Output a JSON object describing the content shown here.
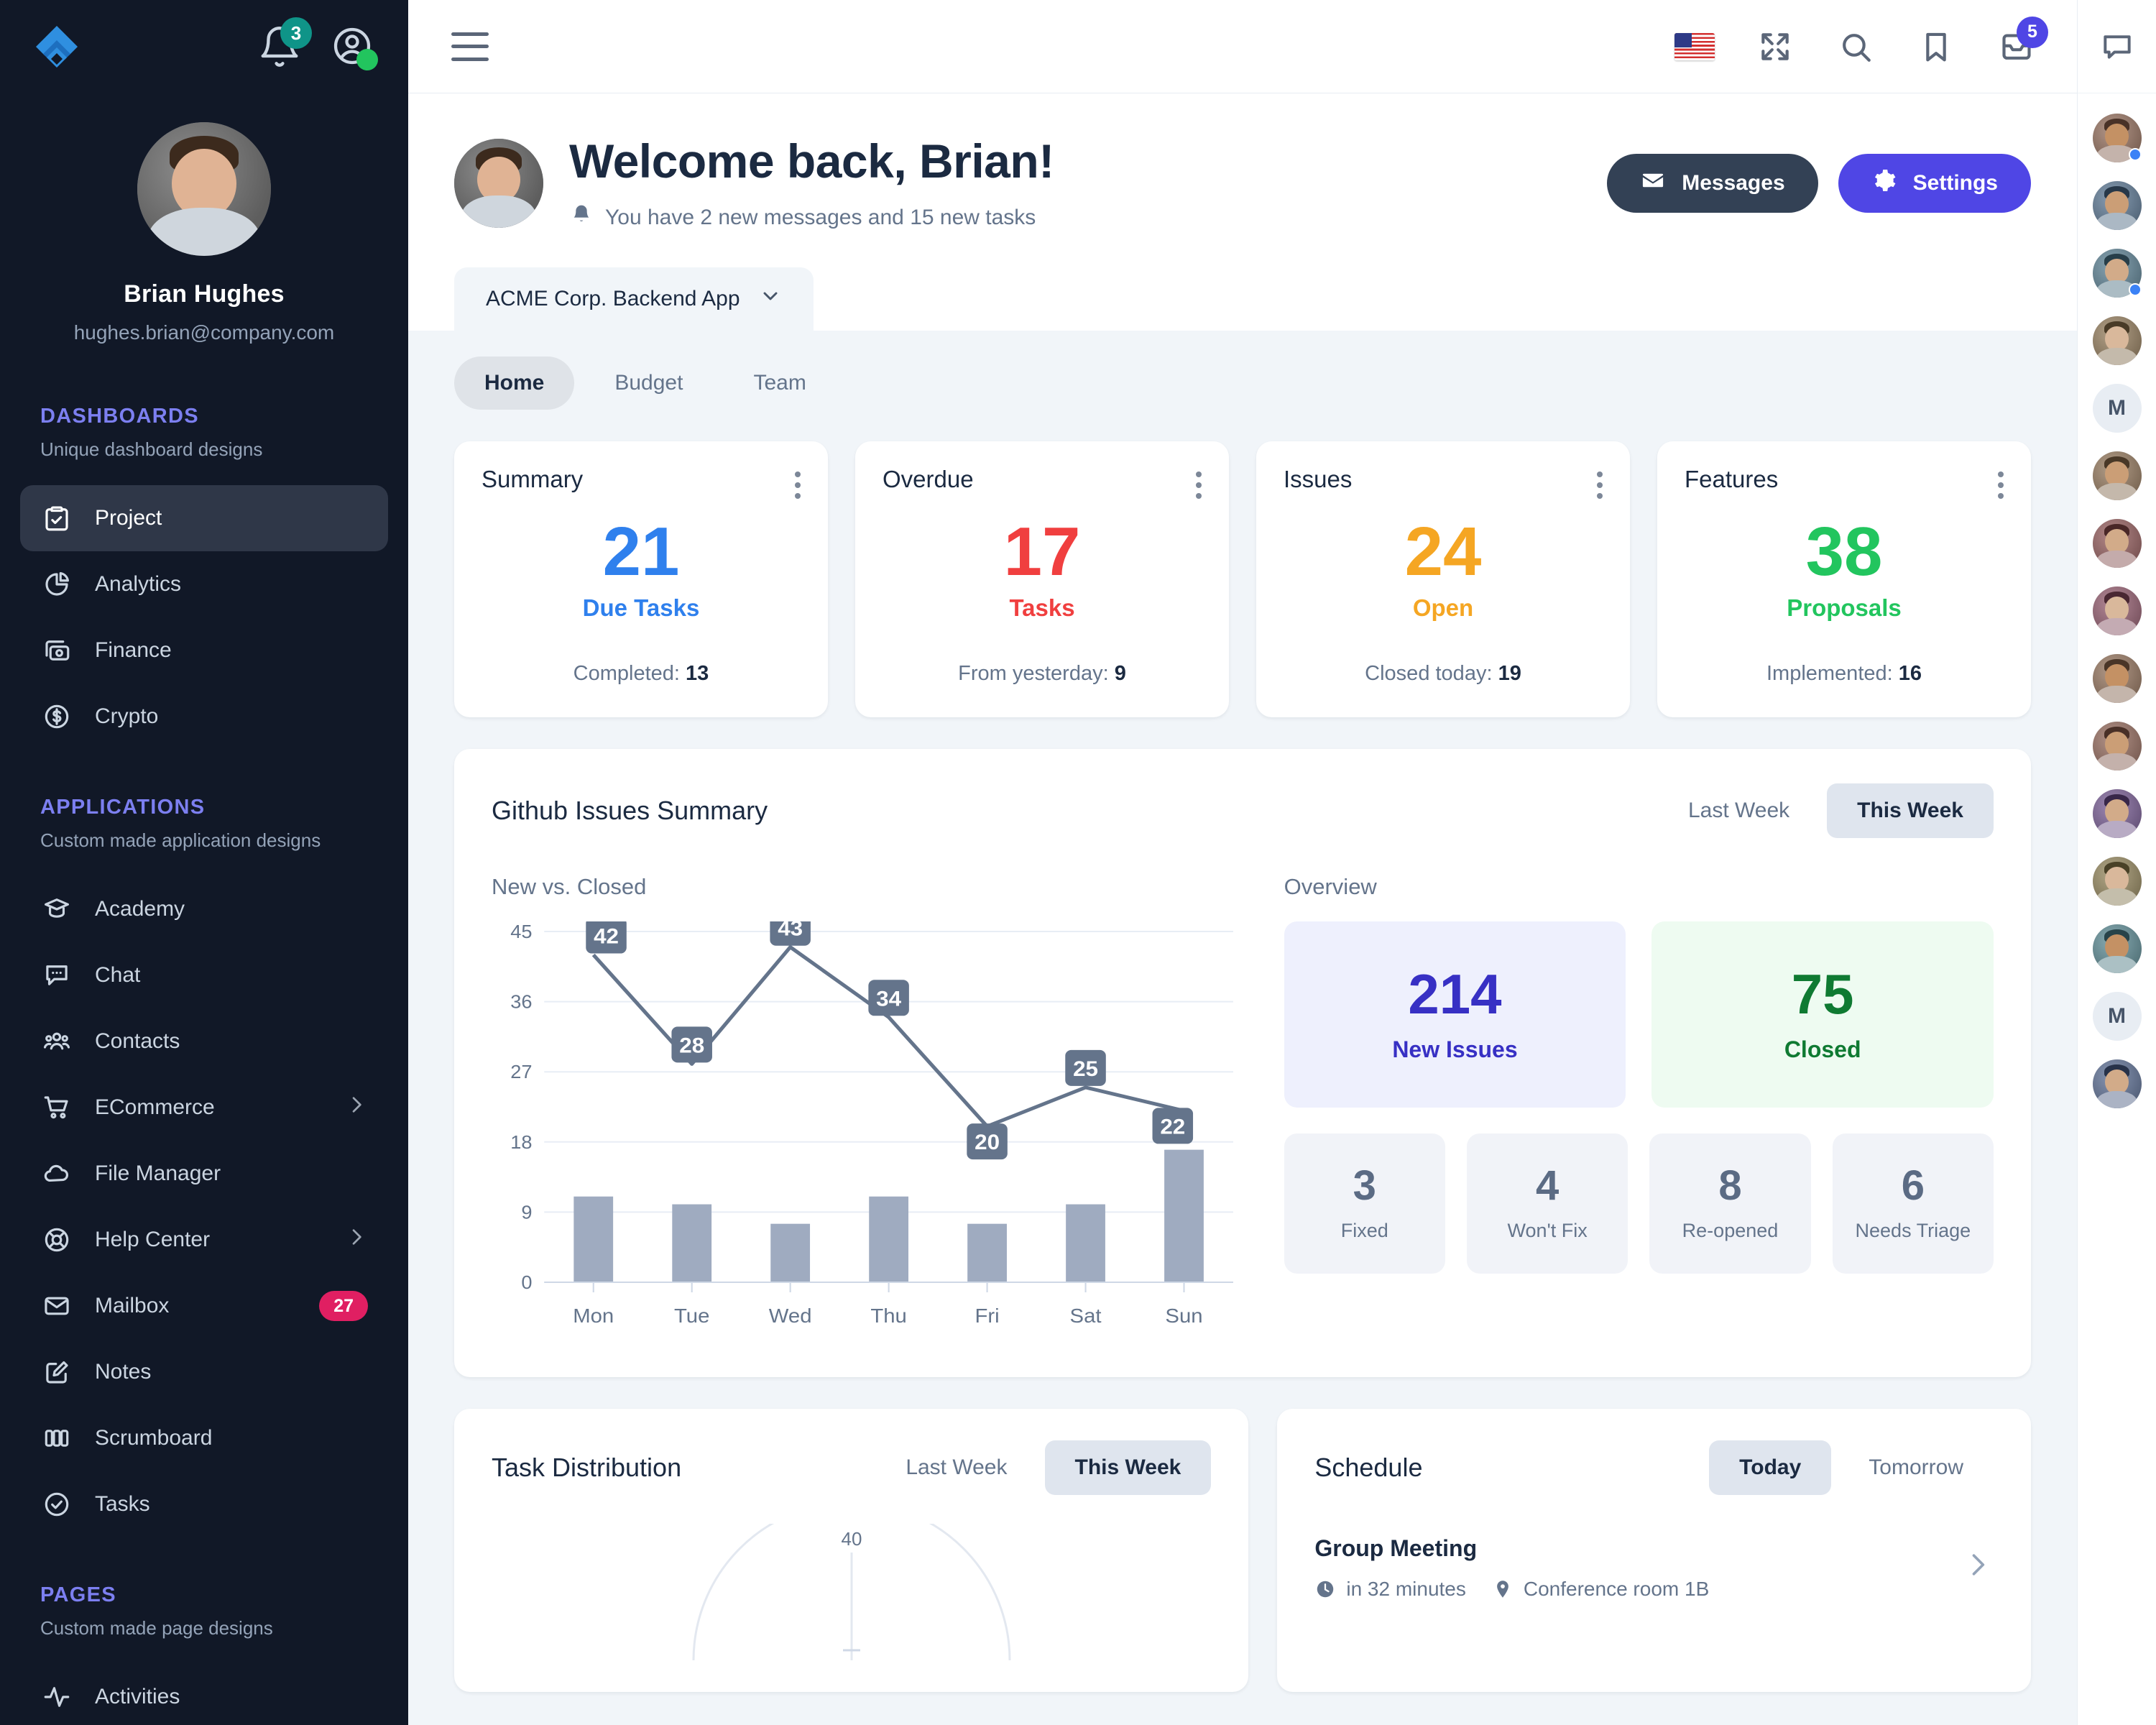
{
  "sidebar": {
    "brand_icon": "logo-icon",
    "notifications_count": "3",
    "profile": {
      "name": "Brian Hughes",
      "email": "hughes.brian@company.com"
    },
    "sections": [
      {
        "title": "DASHBOARDS",
        "subtitle": "Unique dashboard designs",
        "items": [
          {
            "label": "Project",
            "icon": "clipboard-check-icon",
            "active": true
          },
          {
            "label": "Analytics",
            "icon": "pie-chart-icon",
            "active": false
          },
          {
            "label": "Finance",
            "icon": "money-icon",
            "active": false
          },
          {
            "label": "Crypto",
            "icon": "dollar-circle-icon",
            "active": false
          }
        ]
      },
      {
        "title": "APPLICATIONS",
        "subtitle": "Custom made application designs",
        "items": [
          {
            "label": "Academy",
            "icon": "graduation-cap-icon"
          },
          {
            "label": "Chat",
            "icon": "chat-bubble-icon"
          },
          {
            "label": "Contacts",
            "icon": "people-icon"
          },
          {
            "label": "ECommerce",
            "icon": "shopping-cart-icon",
            "chevron": true
          },
          {
            "label": "File Manager",
            "icon": "cloud-icon"
          },
          {
            "label": "Help Center",
            "icon": "lifebuoy-icon",
            "chevron": true
          },
          {
            "label": "Mailbox",
            "icon": "envelope-icon",
            "badge": "27"
          },
          {
            "label": "Notes",
            "icon": "note-edit-icon"
          },
          {
            "label": "Scrumboard",
            "icon": "columns-icon"
          },
          {
            "label": "Tasks",
            "icon": "check-circle-icon"
          }
        ]
      },
      {
        "title": "PAGES",
        "subtitle": "Custom made page designs",
        "items": [
          {
            "label": "Activities",
            "icon": "activity-icon"
          }
        ]
      }
    ]
  },
  "topbar": {
    "menu_icon": "hamburger-icon",
    "icons": [
      "us-flag-icon",
      "fullscreen-icon",
      "search-icon",
      "bookmark-icon",
      "inbox-icon"
    ],
    "inbox_badge": "5"
  },
  "hero": {
    "title": "Welcome back, Brian!",
    "subtitle": "You have 2 new messages and 15 new tasks",
    "bell_icon": "bell-icon",
    "messages_button": "Messages",
    "settings_button": "Settings",
    "project_tab": "ACME Corp. Backend App"
  },
  "subtabs": [
    {
      "label": "Home",
      "active": true
    },
    {
      "label": "Budget",
      "active": false
    },
    {
      "label": "Team",
      "active": false
    }
  ],
  "summary_cards": [
    {
      "title": "Summary",
      "value": "21",
      "value_label": "Due Tasks",
      "foot_label": "Completed:",
      "foot_value": "13",
      "color": "#2f80ed"
    },
    {
      "title": "Overdue",
      "value": "17",
      "value_label": "Tasks",
      "foot_label": "From yesterday:",
      "foot_value": "9",
      "color": "#f03f3f"
    },
    {
      "title": "Issues",
      "value": "24",
      "value_label": "Open",
      "foot_label": "Closed today:",
      "foot_value": "19",
      "color": "#f5a623"
    },
    {
      "title": "Features",
      "value": "38",
      "value_label": "Proposals",
      "foot_label": "Implemented:",
      "foot_value": "16",
      "color": "#22c55e"
    }
  ],
  "github_panel": {
    "title": "Github Issues Summary",
    "range_tabs": [
      {
        "label": "Last Week",
        "active": false
      },
      {
        "label": "This Week",
        "active": true
      }
    ],
    "left_heading": "New vs. Closed",
    "right_heading": "Overview",
    "overview_cards": [
      {
        "value": "214",
        "label": "New Issues",
        "color": "#3730c4",
        "bg": "#eef0fd"
      },
      {
        "value": "75",
        "label": "Closed",
        "color": "#0f7a32",
        "bg": "#eefbf1"
      }
    ],
    "mini_cards": [
      {
        "value": "3",
        "label": "Fixed"
      },
      {
        "value": "4",
        "label": "Won't Fix"
      },
      {
        "value": "8",
        "label": "Re-opened"
      },
      {
        "value": "6",
        "label": "Needs Triage"
      }
    ]
  },
  "task_distribution": {
    "title": "Task Distribution",
    "range_tabs": [
      {
        "label": "Last Week",
        "active": false
      },
      {
        "label": "This Week",
        "active": true
      }
    ],
    "gauge_top_label": "40"
  },
  "schedule": {
    "title": "Schedule",
    "range_tabs": [
      {
        "label": "Today",
        "active": true
      },
      {
        "label": "Tomorrow",
        "active": false
      }
    ],
    "event_title": "Group Meeting",
    "event_time": "in 32 minutes",
    "event_location": "Conference room 1B",
    "clock_icon": "clock-icon",
    "pin_icon": "map-pin-icon",
    "chevron_icon": "chevron-right-icon"
  },
  "chart_data": {
    "type": "line",
    "title": "New vs. Closed",
    "categories": [
      "Mon",
      "Tue",
      "Wed",
      "Thu",
      "Fri",
      "Sat",
      "Sun"
    ],
    "series": [
      {
        "name": "New",
        "type": "line",
        "values": [
          42,
          28,
          43,
          34,
          20,
          25,
          22
        ],
        "color": "#64748b",
        "labels": true
      },
      {
        "name": "Closed",
        "type": "bar",
        "values": [
          11,
          10,
          7.5,
          11,
          7.5,
          10,
          17
        ],
        "color": "#9fabc0",
        "labels": false
      }
    ],
    "ylim": [
      0,
      45
    ],
    "yticks": [
      0,
      9,
      18,
      27,
      36,
      45
    ],
    "xlabel": "",
    "ylabel": "",
    "grid": true,
    "legend": "none"
  },
  "rail": {
    "chat_icon": "chat-panel-icon",
    "contacts": [
      {
        "type": "photo",
        "status": "#3b82f6",
        "hue": 20
      },
      {
        "type": "photo",
        "status": "",
        "hue": 210
      },
      {
        "type": "photo",
        "status": "#3b82f6",
        "hue": 200
      },
      {
        "type": "photo",
        "status": "",
        "hue": 35
      },
      {
        "type": "initial",
        "label": "M",
        "status": ""
      },
      {
        "type": "photo",
        "status": "",
        "hue": 30
      },
      {
        "type": "photo",
        "status": "",
        "hue": 0
      },
      {
        "type": "photo",
        "status": "",
        "hue": 340
      },
      {
        "type": "photo",
        "status": "",
        "hue": 25
      },
      {
        "type": "photo",
        "status": "",
        "hue": 15
      },
      {
        "type": "photo",
        "status": "",
        "hue": 270
      },
      {
        "type": "photo",
        "status": "",
        "hue": 45
      },
      {
        "type": "photo",
        "status": "",
        "hue": 190
      },
      {
        "type": "initial",
        "label": "M",
        "status": ""
      },
      {
        "type": "photo",
        "status": "",
        "hue": 220
      }
    ]
  }
}
